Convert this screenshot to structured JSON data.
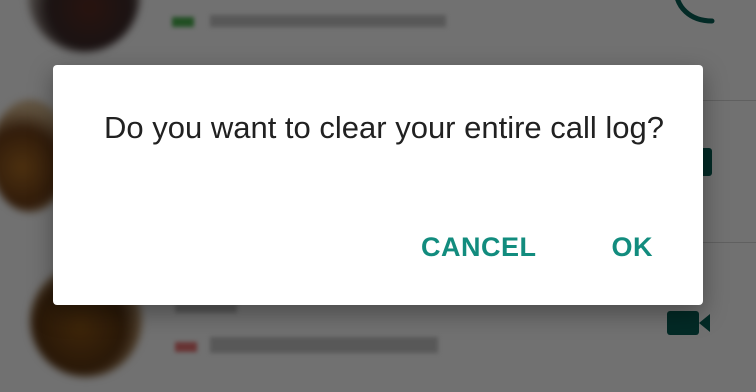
{
  "dialog": {
    "message": "Do you want to clear your entire call log?",
    "cancel_label": "CANCEL",
    "ok_label": "OK"
  },
  "colors": {
    "accent": "#128c7e",
    "icon_green": "#075e54",
    "missed_red": "#e57373",
    "outgoing_green": "#4caf50"
  },
  "background_rows": [
    {
      "icon": "phone-icon"
    },
    {
      "icon": "video-call-icon"
    },
    {
      "icon": "video-call-icon"
    }
  ]
}
